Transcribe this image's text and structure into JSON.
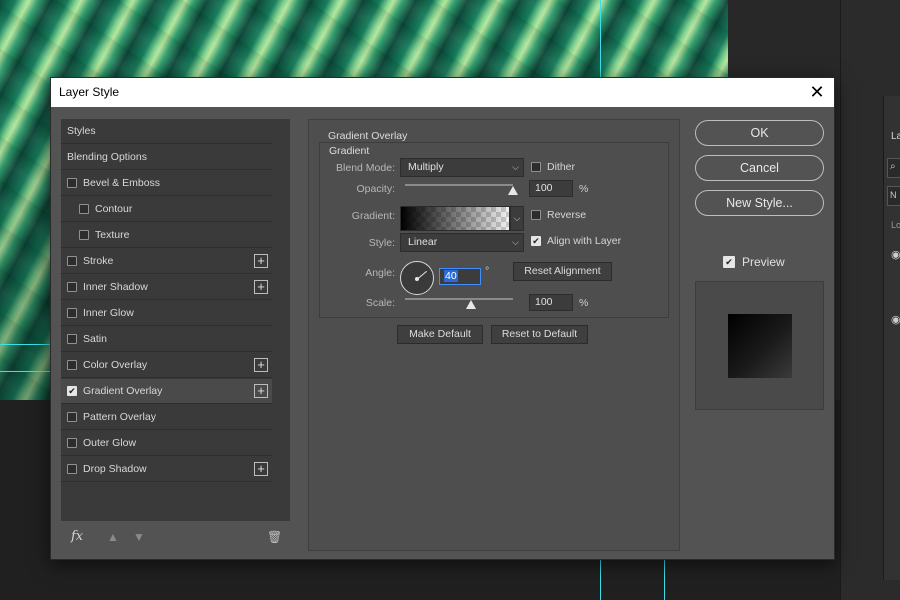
{
  "background": {
    "right_panel": {
      "tab_label": "La",
      "search_icon": "search-icon",
      "field_label": "N",
      "lock_label": "Lo",
      "eye_icon": "eye-icon"
    }
  },
  "dialog": {
    "title": "Layer Style",
    "close_icon": "close-icon",
    "styles_list": [
      {
        "label": "Styles",
        "has_checkbox": false,
        "checked": false,
        "has_plus": false,
        "selected": false,
        "indent": false
      },
      {
        "label": "Blending Options",
        "has_checkbox": false,
        "checked": false,
        "has_plus": false,
        "selected": false,
        "indent": false
      },
      {
        "label": "Bevel & Emboss",
        "has_checkbox": true,
        "checked": false,
        "has_plus": false,
        "selected": false,
        "indent": false
      },
      {
        "label": "Contour",
        "has_checkbox": true,
        "checked": false,
        "has_plus": false,
        "selected": false,
        "indent": true
      },
      {
        "label": "Texture",
        "has_checkbox": true,
        "checked": false,
        "has_plus": false,
        "selected": false,
        "indent": true
      },
      {
        "label": "Stroke",
        "has_checkbox": true,
        "checked": false,
        "has_plus": true,
        "selected": false,
        "indent": false
      },
      {
        "label": "Inner Shadow",
        "has_checkbox": true,
        "checked": false,
        "has_plus": true,
        "selected": false,
        "indent": false
      },
      {
        "label": "Inner Glow",
        "has_checkbox": true,
        "checked": false,
        "has_plus": false,
        "selected": false,
        "indent": false
      },
      {
        "label": "Satin",
        "has_checkbox": true,
        "checked": false,
        "has_plus": false,
        "selected": false,
        "indent": false
      },
      {
        "label": "Color Overlay",
        "has_checkbox": true,
        "checked": false,
        "has_plus": true,
        "selected": false,
        "indent": false
      },
      {
        "label": "Gradient Overlay",
        "has_checkbox": true,
        "checked": true,
        "has_plus": true,
        "selected": true,
        "indent": false
      },
      {
        "label": "Pattern Overlay",
        "has_checkbox": true,
        "checked": false,
        "has_plus": false,
        "selected": false,
        "indent": false
      },
      {
        "label": "Outer Glow",
        "has_checkbox": true,
        "checked": false,
        "has_plus": false,
        "selected": false,
        "indent": false
      },
      {
        "label": "Drop Shadow",
        "has_checkbox": true,
        "checked": false,
        "has_plus": true,
        "selected": false,
        "indent": false
      }
    ],
    "footer": {
      "fx_label": "fx",
      "fx_icon": "fx-icon",
      "up_icon": "arrow-up-icon",
      "down_icon": "arrow-down-icon",
      "trash_icon": "trash-icon"
    },
    "panel": {
      "title": "Gradient Overlay",
      "group_title": "Gradient",
      "blend_mode": {
        "label": "Blend Mode:",
        "value": "Multiply"
      },
      "dither": {
        "label": "Dither",
        "checked": false
      },
      "opacity": {
        "label": "Opacity:",
        "value": "100",
        "unit": "%",
        "level": 1.0
      },
      "gradient": {
        "label": "Gradient:",
        "from": "#000000",
        "to": "transparent"
      },
      "reverse": {
        "label": "Reverse",
        "checked": false
      },
      "style": {
        "label": "Style:",
        "value": "Linear"
      },
      "align_with_layer": {
        "label": "Align with Layer",
        "checked": true
      },
      "angle": {
        "label": "Angle:",
        "value": "40",
        "unit": "°"
      },
      "reset_alignment": "Reset Alignment",
      "scale": {
        "label": "Scale:",
        "value": "100",
        "unit": "%",
        "level": 0.5
      },
      "make_default": "Make Default",
      "reset_to_default": "Reset to Default"
    },
    "buttons": {
      "ok": "OK",
      "cancel": "Cancel",
      "new_style": "New Style..."
    },
    "preview": {
      "label": "Preview",
      "checked": true
    }
  },
  "colors": {
    "guide": "#3de0e8",
    "dialog_bg": "#535353",
    "selected_row": "#4a4a4a"
  }
}
